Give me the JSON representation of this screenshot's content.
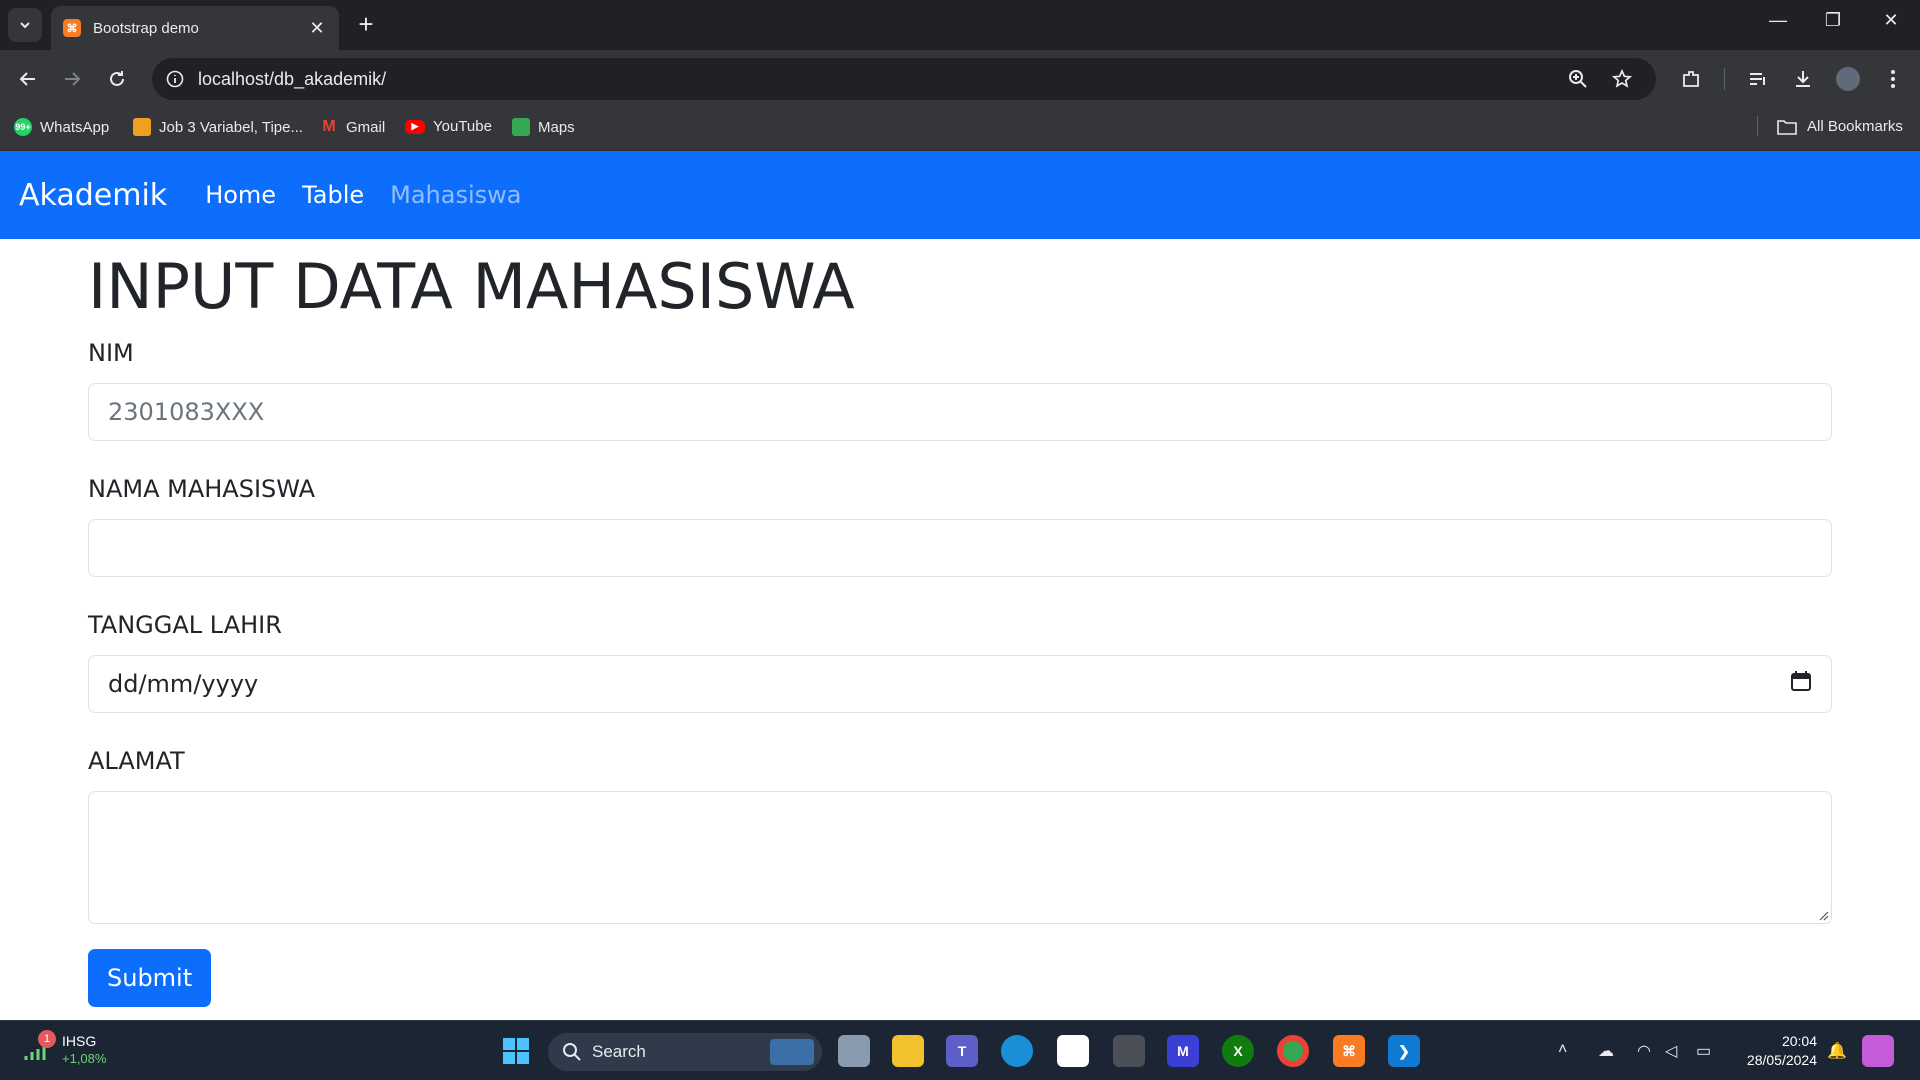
{
  "browser": {
    "tab_title": "Bootstrap demo",
    "url": "localhost/db_akademik/",
    "bookmarks": [
      {
        "label": "WhatsApp",
        "icon": "whatsapp-icon"
      },
      {
        "label": "Job 3 Variabel, Tipe...",
        "icon": "job-icon"
      },
      {
        "label": "Gmail",
        "icon": "gmail-icon"
      },
      {
        "label": "YouTube",
        "icon": "youtube-icon"
      },
      {
        "label": "Maps",
        "icon": "maps-icon"
      }
    ],
    "all_bookmarks": "All Bookmarks",
    "whatsapp_badge": "99+"
  },
  "navbar": {
    "brand": "Akademik",
    "links": [
      "Home",
      "Table",
      "Mahasiswa"
    ],
    "color": "#0d6efd"
  },
  "form": {
    "title": "INPUT DATA MAHASISWA",
    "nim_label": "NIM",
    "nim_placeholder": "2301083XXX",
    "nama_label": "NAMA MAHASISWA",
    "nama_value": "",
    "tanggal_label": "TANGGAL LAHIR",
    "tanggal_value": "dd/mm/yyyy",
    "alamat_label": "ALAMAT",
    "alamat_value": "",
    "submit_label": "Submit"
  },
  "taskbar": {
    "stock_name": "IHSG",
    "stock_change": "+1,08%",
    "stock_badge": "1",
    "search_label": "Search",
    "time": "20:04",
    "date": "28/05/2024"
  }
}
